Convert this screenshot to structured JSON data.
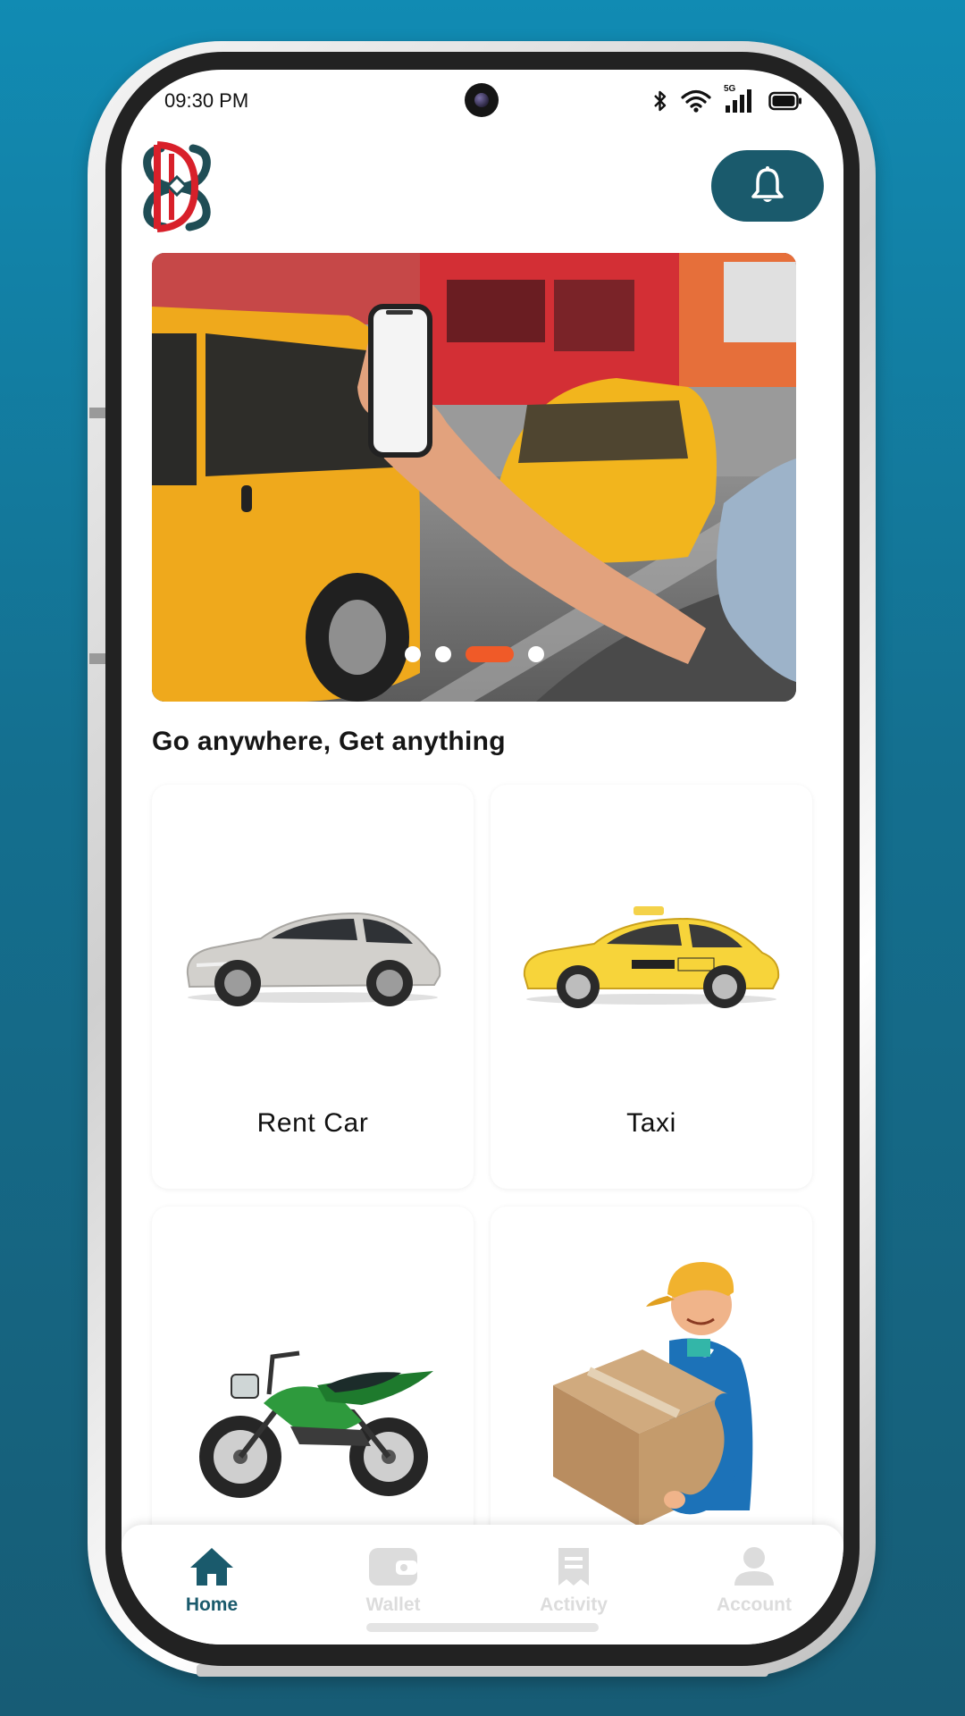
{
  "status_bar": {
    "time": "09:30 PM",
    "network": "5G"
  },
  "header": {
    "logo_icon": "monogram-logo",
    "notification_icon": "bell-icon"
  },
  "banner": {
    "slides": 4,
    "active_slide": 3
  },
  "headline": "Go anywhere, Get anything",
  "services": [
    {
      "label": "Rent Car",
      "icon": "silver-car"
    },
    {
      "label": "Taxi",
      "icon": "yellow-taxi"
    },
    {
      "label": "",
      "icon": "green-motorcycle"
    },
    {
      "label": "",
      "icon": "delivery-courier"
    }
  ],
  "bottom_nav": {
    "items": [
      {
        "label": "Home",
        "icon": "home-icon",
        "active": true
      },
      {
        "label": "Wallet",
        "icon": "wallet-icon",
        "active": false
      },
      {
        "label": "Activity",
        "icon": "receipt-icon",
        "active": false
      },
      {
        "label": "Account",
        "icon": "user-icon",
        "active": false
      }
    ]
  },
  "colors": {
    "accent": "#1a5a6c",
    "indicator": "#f05a28",
    "logo_red": "#d8202a"
  }
}
